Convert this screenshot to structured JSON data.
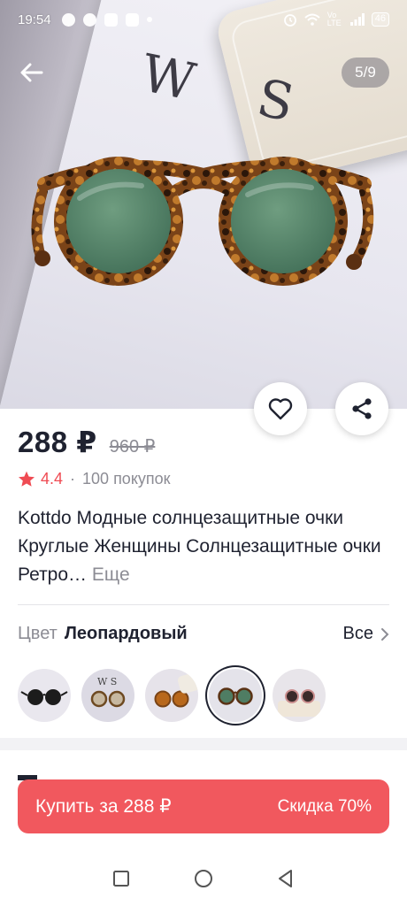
{
  "status_bar": {
    "time": "19:54",
    "network_label": "Vo LTE",
    "battery": "46"
  },
  "gallery": {
    "brand_text": "W S",
    "counter": "5/9",
    "back_icon": "arrow-left-icon"
  },
  "actions": {
    "favorite_icon": "heart-icon",
    "share_icon": "share-icon"
  },
  "product": {
    "price": "288 ₽",
    "old_price": "960 ₽",
    "rating": "4.4",
    "rating_separator": "·",
    "purchases": "100 покупок",
    "title": "Kottdo Модные солнцезащитные очки Круглые Женщины Солнцезащитные очки Ретро…",
    "more_label": "Еще"
  },
  "color": {
    "label": "Цвет",
    "value": "Леопардовый",
    "all_label": "Все",
    "selected_index": 3,
    "options": [
      "black",
      "tortoise-clear",
      "amber",
      "leopard-green",
      "pink-dark"
    ]
  },
  "buy": {
    "label": "Купить за 288 ₽",
    "discount": "Скидка 70%"
  },
  "colors": {
    "accent": "#f1585e",
    "rating_red": "#ef4b53",
    "text_primary": "#1f2230",
    "text_muted": "#8c8c94"
  },
  "navbar": {
    "items": [
      "recents-square-icon",
      "home-circle-icon",
      "back-triangle-icon"
    ]
  }
}
